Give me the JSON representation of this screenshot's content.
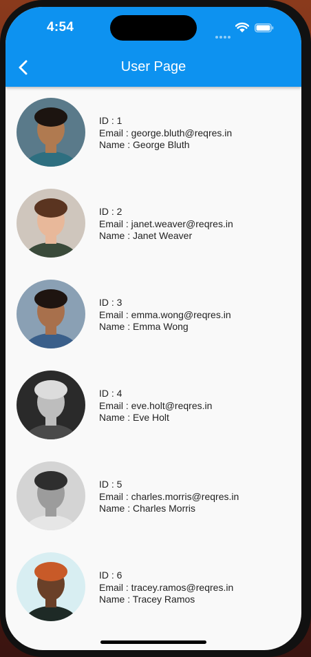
{
  "status_bar": {
    "time": "4:54"
  },
  "app_bar": {
    "title": "User Page",
    "back_icon": "chevron-left-icon"
  },
  "users": [
    {
      "id_line": "ID : 1",
      "email_line": "Email : george.bluth@reqres.in",
      "name_line": "Name : George Bluth",
      "avatar_bg": "#5a7a8a",
      "skin": "#b07a50",
      "hair": "#1c1410",
      "shirt": "#2e6f80"
    },
    {
      "id_line": "ID : 2",
      "email_line": "Email : janet.weaver@reqres.in",
      "name_line": "Name : Janet Weaver",
      "avatar_bg": "#cfc6bd",
      "skin": "#e8b89a",
      "hair": "#5a3420",
      "shirt": "#3a4a3a"
    },
    {
      "id_line": "ID : 3",
      "email_line": "Email : emma.wong@reqres.in",
      "name_line": "Name : Emma Wong",
      "avatar_bg": "#8aa0b4",
      "skin": "#a8704c",
      "hair": "#1e1410",
      "shirt": "#3a5f8a"
    },
    {
      "id_line": "ID : 4",
      "email_line": "Email : eve.holt@reqres.in",
      "name_line": "Name : Eve Holt",
      "avatar_bg": "#2a2a2a",
      "skin": "#bdbdbd",
      "hair": "#dcdcdc",
      "shirt": "#4a4a4a"
    },
    {
      "id_line": "ID : 5",
      "email_line": "Email : charles.morris@reqres.in",
      "name_line": "Name : Charles Morris",
      "avatar_bg": "#d4d4d4",
      "skin": "#9c9c9c",
      "hair": "#2e2e2e",
      "shirt": "#e6e6e6"
    },
    {
      "id_line": "ID : 6",
      "email_line": "Email : tracey.ramos@reqres.in",
      "name_line": "Name : Tracey Ramos",
      "avatar_bg": "#d8eef2",
      "skin": "#6a4028",
      "hair": "#c85a28",
      "shirt": "#1e2a26"
    }
  ],
  "colors": {
    "app_bar": "#0d92f0",
    "background": "#f9f9f9",
    "text": "#222222"
  }
}
